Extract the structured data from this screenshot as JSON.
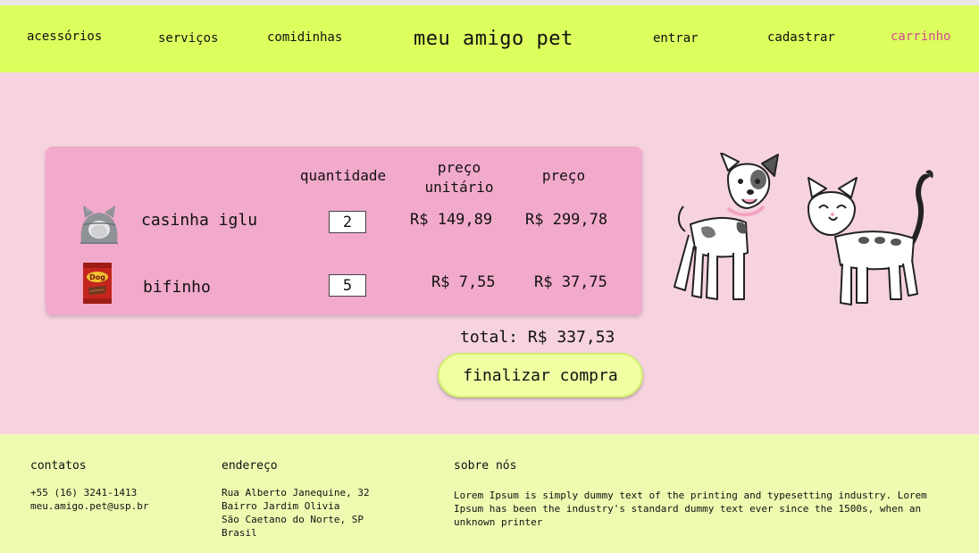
{
  "nav": {
    "accessories": "acessórios",
    "services": "serviços",
    "treats": "comidinhas",
    "brand": "meu amigo pet",
    "login": "entrar",
    "register": "cadastrar",
    "cart": "carrinho"
  },
  "cart": {
    "headers": {
      "quantity": "quantidade",
      "unit_price_line1": "preço",
      "unit_price_line2": "unitário",
      "price": "preço"
    },
    "items": [
      {
        "name": "casinha iglu",
        "quantity": "2",
        "unit_price": "R$ 149,89",
        "price": "R$ 299,78",
        "icon": "igloo-bed-image"
      },
      {
        "name": "bifinho",
        "quantity": "5",
        "unit_price": "R$ 7,55",
        "price": "R$ 37,75",
        "icon": "dog-treat-bag-image"
      }
    ],
    "total": "total: R$ 337,53",
    "checkout_label": "finalizar compra"
  },
  "footer": {
    "contacts": {
      "title": "contatos",
      "text": "+55 (16) 3241-1413\nmeu.amigo.pet@usp.br"
    },
    "address": {
      "title": "endereço",
      "text": "Rua Alberto Janequine, 32\nBairro Jardim Olivia\nSão Caetano do Norte, SP\nBrasil"
    },
    "about": {
      "title": "sobre nós",
      "text": "Lorem Ipsum is simply dummy text of the printing and typesetting industry. Lorem Ipsum has been the industry's standard dummy text ever since the 1500s, when an unknown printer"
    }
  },
  "colors": {
    "header_bg": "#ddff5e",
    "main_bg": "#f6d3df",
    "card_bg": "#f2aacb",
    "footer_bg": "#edfbb1",
    "cart_link": "#d0469a"
  }
}
